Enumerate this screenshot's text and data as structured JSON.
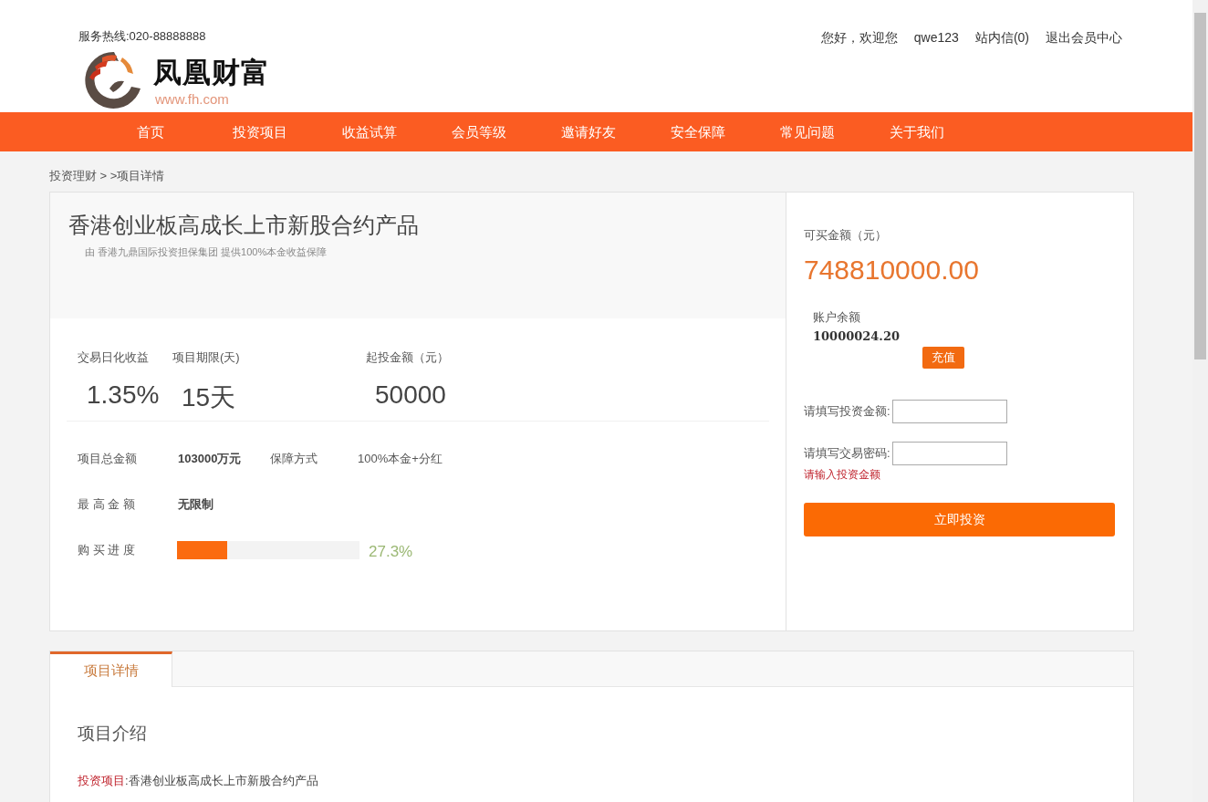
{
  "header": {
    "hotline": "服务热线:020-88888888",
    "logo": {
      "name": "凤凰财富",
      "url": "www.fh.com"
    },
    "user_links": [
      {
        "label": "您好，欢迎您"
      },
      {
        "label": "qwe123"
      },
      {
        "label": "站内信(0)"
      },
      {
        "label": "退出会员中心"
      }
    ]
  },
  "nav": [
    {
      "label": "首页"
    },
    {
      "label": "投资项目"
    },
    {
      "label": "收益试算"
    },
    {
      "label": "会员等级"
    },
    {
      "label": "邀请好友"
    },
    {
      "label": "安全保障"
    },
    {
      "label": "常见问题"
    },
    {
      "label": "关于我们"
    }
  ],
  "breadcrumb": "投资理财 > >项目详情",
  "product": {
    "title": "香港创业板高成长上市新股合约产品",
    "subtitle": "由 香港九鼎国际投资担保集团 提供100%本金收益保障",
    "stats": [
      {
        "label": "交易日化收益",
        "value": "1.35%"
      },
      {
        "label": "项目期限(天)",
        "value": "15天"
      },
      {
        "label": "起投金额（元）",
        "value": "50000"
      }
    ],
    "detail_rows": [
      [
        {
          "label": "项目总金额",
          "value": "103000万元",
          "bold": true
        },
        {
          "label": "保障方式",
          "value": "100%本金+分红",
          "bold": false
        }
      ],
      [
        {
          "label": "最 高 金 额",
          "value": "无限制",
          "bold": true
        }
      ]
    ],
    "progress": {
      "label": "购 买 进 度",
      "level": 0.273,
      "reading": "27.3%"
    }
  },
  "purchase": {
    "available_label": "可买金额（元）",
    "available_amount": "748810000.00",
    "balance_label": "账户余额",
    "balance": "10000024.20",
    "recharge_button": "充值",
    "fields": [
      {
        "label": "请填写投资金额:"
      },
      {
        "label": "请填写交易密码:"
      }
    ],
    "error": "请输入投资金额",
    "invest_button": "立即投资"
  },
  "tabs": [
    {
      "label": "项目详情",
      "selected": true
    }
  ],
  "section_title": "项目介绍",
  "intro": {
    "label": "投资项目",
    "text": ":香港创业板高成长上市新股合约产品"
  }
}
